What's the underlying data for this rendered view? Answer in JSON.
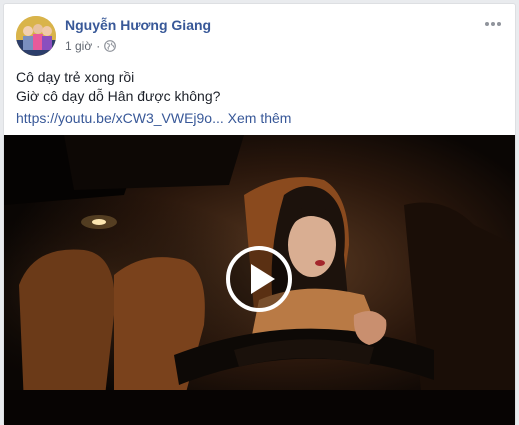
{
  "post": {
    "author": "Nguyễn Hương Giang",
    "time": "1 giờ",
    "dot": "·",
    "privacy_icon": "globe-icon",
    "more_icon": "more-horizontal-icon",
    "lines": [
      "Cô dạy trẻ xong rồi",
      "Giờ cô dạy dỗ Hân được không?"
    ],
    "link": "https://youtu.be/xCW3_VWEj9o...",
    "see_more": "Xem thêm"
  },
  "video": {
    "play_icon": "play-icon"
  },
  "colors": {
    "author": "#385898",
    "link": "#385898",
    "text": "#1d2129",
    "meta": "#616770",
    "page_bg": "#e9ebee"
  }
}
